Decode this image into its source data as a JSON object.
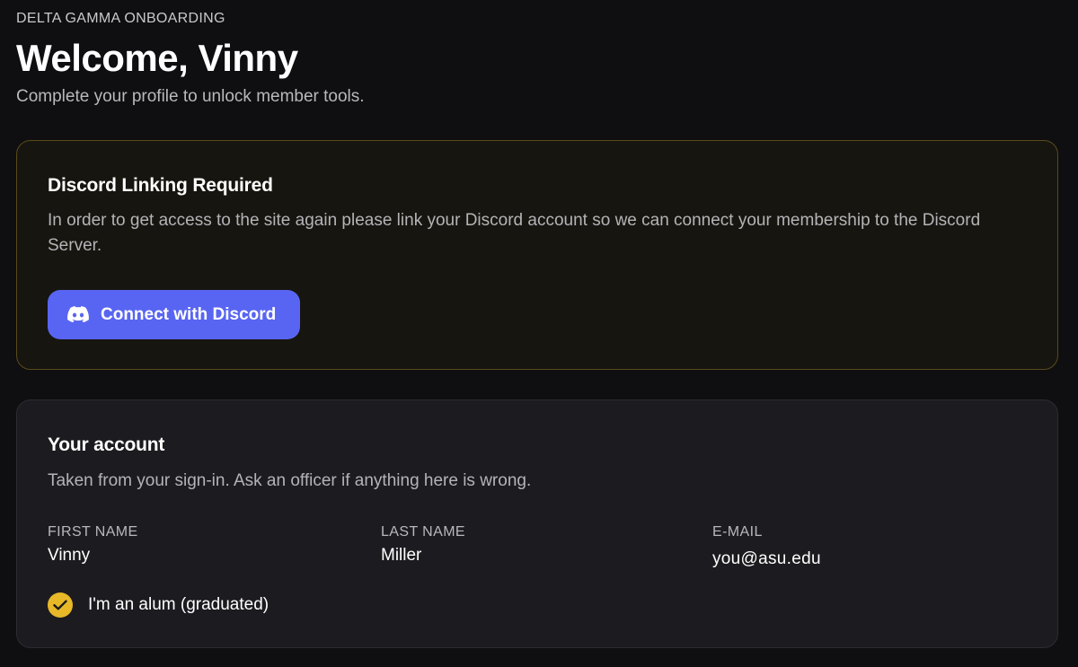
{
  "header": {
    "eyebrow": "DELTA GAMMA ONBOARDING",
    "title": "Welcome, Vinny",
    "subtitle": "Complete your profile to unlock member tools."
  },
  "discord_card": {
    "title": "Discord Linking Required",
    "text": "In order to get access to the site again please link your Discord account so we can connect your membership to the Discord Server.",
    "button_label": "Connect with Discord",
    "button_icon": "discord-icon",
    "button_color": "#5865f2"
  },
  "account_card": {
    "title": "Your account",
    "text": "Taken from your sign-in. Ask an officer if anything here is wrong.",
    "fields": [
      {
        "label": "FIRST NAME",
        "value": "Vinny"
      },
      {
        "label": "LAST NAME",
        "value": "Miller"
      },
      {
        "label": "E-MAIL",
        "value": "you@asu.edu"
      }
    ],
    "alum_checkbox": {
      "label": "I'm an alum (graduated)",
      "checked": true,
      "icon": "checkmark-icon",
      "color": "#e8b829"
    }
  }
}
